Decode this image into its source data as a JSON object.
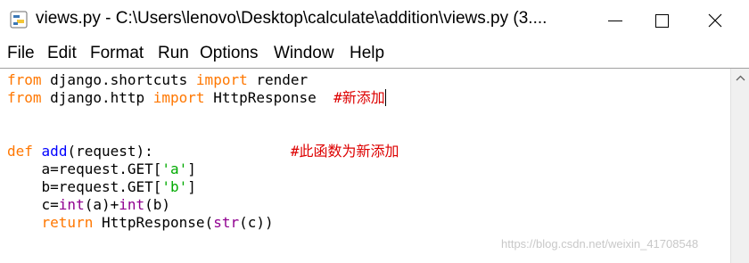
{
  "window": {
    "title": "views.py - C:\\Users\\lenovo\\Desktop\\calculate\\addition\\views.py (3....",
    "icon": "python-idle-icon"
  },
  "menu": [
    "File",
    "Edit",
    "Format",
    "Run",
    "Options",
    "Window",
    "Help"
  ],
  "code": {
    "lines": [
      [
        {
          "t": "from",
          "c": "kw"
        },
        {
          "t": " django.shortcuts "
        },
        {
          "t": "import",
          "c": "kw"
        },
        {
          "t": " render"
        }
      ],
      [
        {
          "t": "from",
          "c": "kw"
        },
        {
          "t": " django.http "
        },
        {
          "t": "import",
          "c": "kw"
        },
        {
          "t": " HttpResponse  "
        },
        {
          "t": "#新添加",
          "c": "cm"
        },
        {
          "caret": true
        }
      ],
      [],
      [],
      [
        {
          "t": "def",
          "c": "kw"
        },
        {
          "t": " "
        },
        {
          "t": "add",
          "c": "df"
        },
        {
          "t": "(request):                "
        },
        {
          "t": "#此函数为新添加",
          "c": "cm"
        }
      ],
      [
        {
          "t": "    a=request.GET["
        },
        {
          "t": "'a'",
          "c": "st"
        },
        {
          "t": "]"
        }
      ],
      [
        {
          "t": "    b=request.GET["
        },
        {
          "t": "'b'",
          "c": "st"
        },
        {
          "t": "]"
        }
      ],
      [
        {
          "t": "    c="
        },
        {
          "t": "int",
          "c": "bi"
        },
        {
          "t": "(a)+"
        },
        {
          "t": "int",
          "c": "bi"
        },
        {
          "t": "(b)"
        }
      ],
      [
        {
          "t": "    "
        },
        {
          "t": "return",
          "c": "kw"
        },
        {
          "t": " HttpResponse("
        },
        {
          "t": "str",
          "c": "bi"
        },
        {
          "t": "(c))"
        }
      ]
    ]
  },
  "watermark": "https://blog.csdn.net/weixin_41708548"
}
